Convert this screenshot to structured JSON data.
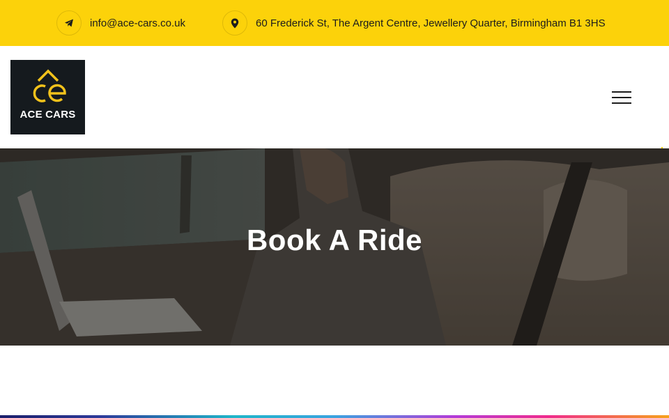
{
  "topbar": {
    "email": "info@ace-cars.co.uk",
    "address": "60 Frederick St, The Argent Centre, Jewellery Quarter, Birmingham B1 3HS",
    "icons": {
      "email": "paper-plane-icon",
      "address": "map-pin-icon"
    },
    "background": "#fcd20a"
  },
  "header": {
    "logo_text": "ACE CARS",
    "logo_icon": "ace-logo-mark",
    "menu_icon": "hamburger-icon"
  },
  "hero": {
    "title": "Book A Ride"
  },
  "colors": {
    "accent": "#fcd20a",
    "logo_bg": "#151a1e",
    "text_dark": "#1c1c1c"
  }
}
